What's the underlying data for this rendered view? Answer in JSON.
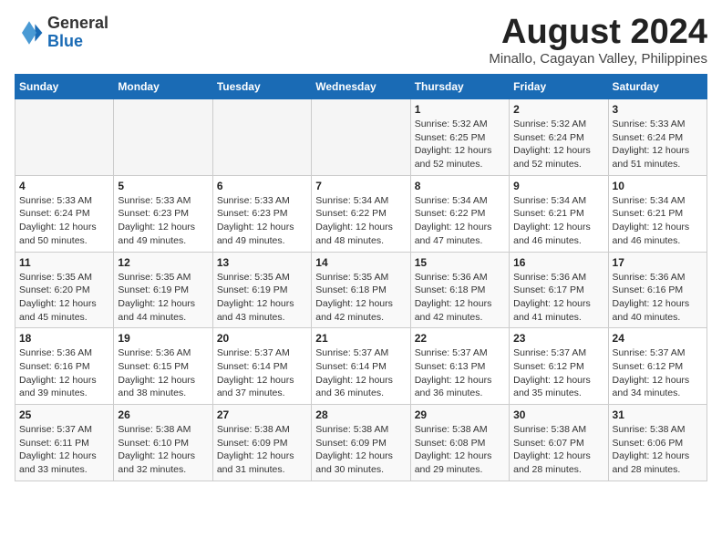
{
  "header": {
    "logo_general": "General",
    "logo_blue": "Blue",
    "month_title": "August 2024",
    "subtitle": "Minallo, Cagayan Valley, Philippines"
  },
  "days_of_week": [
    "Sunday",
    "Monday",
    "Tuesday",
    "Wednesday",
    "Thursday",
    "Friday",
    "Saturday"
  ],
  "weeks": [
    [
      {
        "day": "",
        "info": ""
      },
      {
        "day": "",
        "info": ""
      },
      {
        "day": "",
        "info": ""
      },
      {
        "day": "",
        "info": ""
      },
      {
        "day": "1",
        "info": "Sunrise: 5:32 AM\nSunset: 6:25 PM\nDaylight: 12 hours\nand 52 minutes."
      },
      {
        "day": "2",
        "info": "Sunrise: 5:32 AM\nSunset: 6:24 PM\nDaylight: 12 hours\nand 52 minutes."
      },
      {
        "day": "3",
        "info": "Sunrise: 5:33 AM\nSunset: 6:24 PM\nDaylight: 12 hours\nand 51 minutes."
      }
    ],
    [
      {
        "day": "4",
        "info": "Sunrise: 5:33 AM\nSunset: 6:24 PM\nDaylight: 12 hours\nand 50 minutes."
      },
      {
        "day": "5",
        "info": "Sunrise: 5:33 AM\nSunset: 6:23 PM\nDaylight: 12 hours\nand 49 minutes."
      },
      {
        "day": "6",
        "info": "Sunrise: 5:33 AM\nSunset: 6:23 PM\nDaylight: 12 hours\nand 49 minutes."
      },
      {
        "day": "7",
        "info": "Sunrise: 5:34 AM\nSunset: 6:22 PM\nDaylight: 12 hours\nand 48 minutes."
      },
      {
        "day": "8",
        "info": "Sunrise: 5:34 AM\nSunset: 6:22 PM\nDaylight: 12 hours\nand 47 minutes."
      },
      {
        "day": "9",
        "info": "Sunrise: 5:34 AM\nSunset: 6:21 PM\nDaylight: 12 hours\nand 46 minutes."
      },
      {
        "day": "10",
        "info": "Sunrise: 5:34 AM\nSunset: 6:21 PM\nDaylight: 12 hours\nand 46 minutes."
      }
    ],
    [
      {
        "day": "11",
        "info": "Sunrise: 5:35 AM\nSunset: 6:20 PM\nDaylight: 12 hours\nand 45 minutes."
      },
      {
        "day": "12",
        "info": "Sunrise: 5:35 AM\nSunset: 6:19 PM\nDaylight: 12 hours\nand 44 minutes."
      },
      {
        "day": "13",
        "info": "Sunrise: 5:35 AM\nSunset: 6:19 PM\nDaylight: 12 hours\nand 43 minutes."
      },
      {
        "day": "14",
        "info": "Sunrise: 5:35 AM\nSunset: 6:18 PM\nDaylight: 12 hours\nand 42 minutes."
      },
      {
        "day": "15",
        "info": "Sunrise: 5:36 AM\nSunset: 6:18 PM\nDaylight: 12 hours\nand 42 minutes."
      },
      {
        "day": "16",
        "info": "Sunrise: 5:36 AM\nSunset: 6:17 PM\nDaylight: 12 hours\nand 41 minutes."
      },
      {
        "day": "17",
        "info": "Sunrise: 5:36 AM\nSunset: 6:16 PM\nDaylight: 12 hours\nand 40 minutes."
      }
    ],
    [
      {
        "day": "18",
        "info": "Sunrise: 5:36 AM\nSunset: 6:16 PM\nDaylight: 12 hours\nand 39 minutes."
      },
      {
        "day": "19",
        "info": "Sunrise: 5:36 AM\nSunset: 6:15 PM\nDaylight: 12 hours\nand 38 minutes."
      },
      {
        "day": "20",
        "info": "Sunrise: 5:37 AM\nSunset: 6:14 PM\nDaylight: 12 hours\nand 37 minutes."
      },
      {
        "day": "21",
        "info": "Sunrise: 5:37 AM\nSunset: 6:14 PM\nDaylight: 12 hours\nand 36 minutes."
      },
      {
        "day": "22",
        "info": "Sunrise: 5:37 AM\nSunset: 6:13 PM\nDaylight: 12 hours\nand 36 minutes."
      },
      {
        "day": "23",
        "info": "Sunrise: 5:37 AM\nSunset: 6:12 PM\nDaylight: 12 hours\nand 35 minutes."
      },
      {
        "day": "24",
        "info": "Sunrise: 5:37 AM\nSunset: 6:12 PM\nDaylight: 12 hours\nand 34 minutes."
      }
    ],
    [
      {
        "day": "25",
        "info": "Sunrise: 5:37 AM\nSunset: 6:11 PM\nDaylight: 12 hours\nand 33 minutes."
      },
      {
        "day": "26",
        "info": "Sunrise: 5:38 AM\nSunset: 6:10 PM\nDaylight: 12 hours\nand 32 minutes."
      },
      {
        "day": "27",
        "info": "Sunrise: 5:38 AM\nSunset: 6:09 PM\nDaylight: 12 hours\nand 31 minutes."
      },
      {
        "day": "28",
        "info": "Sunrise: 5:38 AM\nSunset: 6:09 PM\nDaylight: 12 hours\nand 30 minutes."
      },
      {
        "day": "29",
        "info": "Sunrise: 5:38 AM\nSunset: 6:08 PM\nDaylight: 12 hours\nand 29 minutes."
      },
      {
        "day": "30",
        "info": "Sunrise: 5:38 AM\nSunset: 6:07 PM\nDaylight: 12 hours\nand 28 minutes."
      },
      {
        "day": "31",
        "info": "Sunrise: 5:38 AM\nSunset: 6:06 PM\nDaylight: 12 hours\nand 28 minutes."
      }
    ]
  ]
}
